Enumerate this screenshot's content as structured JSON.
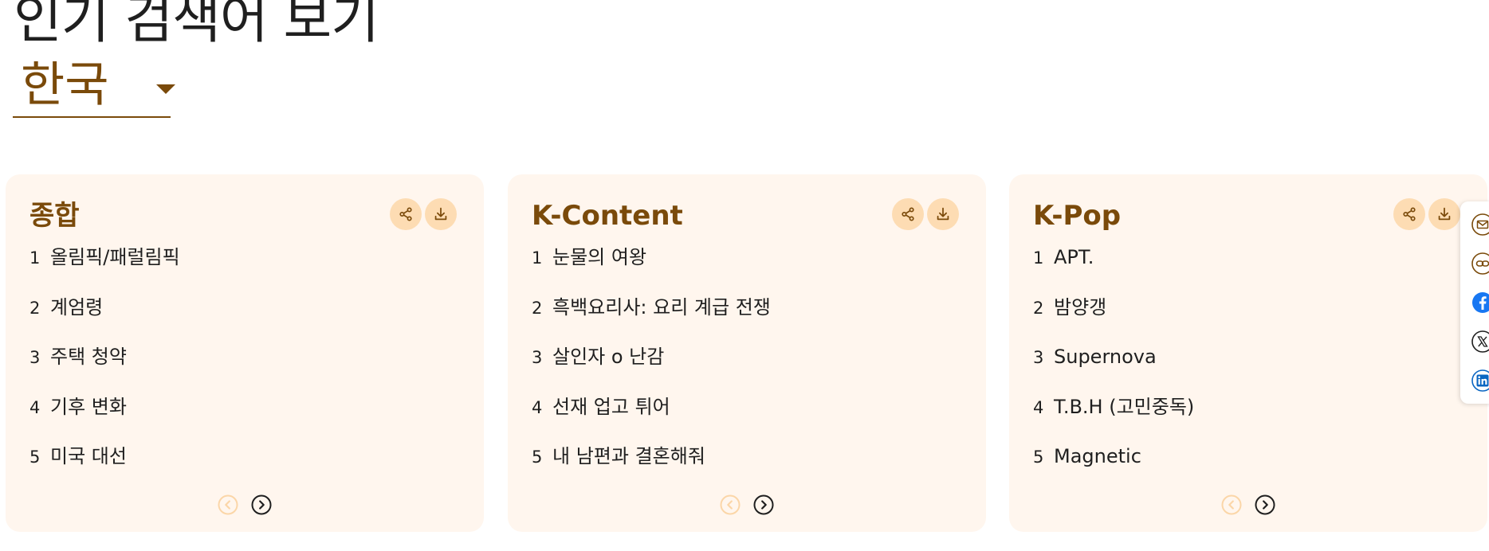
{
  "page": {
    "heading": "인기 검색어 보기",
    "region": {
      "selected": "한국"
    }
  },
  "colors": {
    "accent": "#7a4a0a",
    "card_bg": "#fff6ee",
    "button_bg": "#fddcb3",
    "facebook": "#1877f2",
    "linkedin": "#0a66c2"
  },
  "cards": [
    {
      "title": "종합",
      "items": [
        {
          "rank": "1",
          "text": "올림픽/패럴림픽"
        },
        {
          "rank": "2",
          "text": "계엄령"
        },
        {
          "rank": "3",
          "text": "주택 청약"
        },
        {
          "rank": "4",
          "text": "기후 변화"
        },
        {
          "rank": "5",
          "text": "미국 대선"
        }
      ]
    },
    {
      "title": "K-Content",
      "items": [
        {
          "rank": "1",
          "text": "눈물의 여왕"
        },
        {
          "rank": "2",
          "text": "흑백요리사: 요리 계급 전쟁"
        },
        {
          "rank": "3",
          "text": "살인자 o 난감"
        },
        {
          "rank": "4",
          "text": "선재 업고 튀어"
        },
        {
          "rank": "5",
          "text": "내 남편과 결혼해줘"
        }
      ]
    },
    {
      "title": "K-Pop",
      "items": [
        {
          "rank": "1",
          "text": "APT."
        },
        {
          "rank": "2",
          "text": "밤양갱"
        },
        {
          "rank": "3",
          "text": "Supernova"
        },
        {
          "rank": "4",
          "text": "T.B.H (고민중독)"
        },
        {
          "rank": "5",
          "text": "Magnetic"
        }
      ]
    }
  ],
  "icons": {
    "card_actions": [
      "share-icon",
      "download-icon"
    ],
    "pager": [
      "chevron-left-icon",
      "chevron-right-icon"
    ],
    "share_sidebar": [
      "mail-icon",
      "link-icon",
      "facebook-icon",
      "x-icon",
      "linkedin-icon"
    ]
  }
}
